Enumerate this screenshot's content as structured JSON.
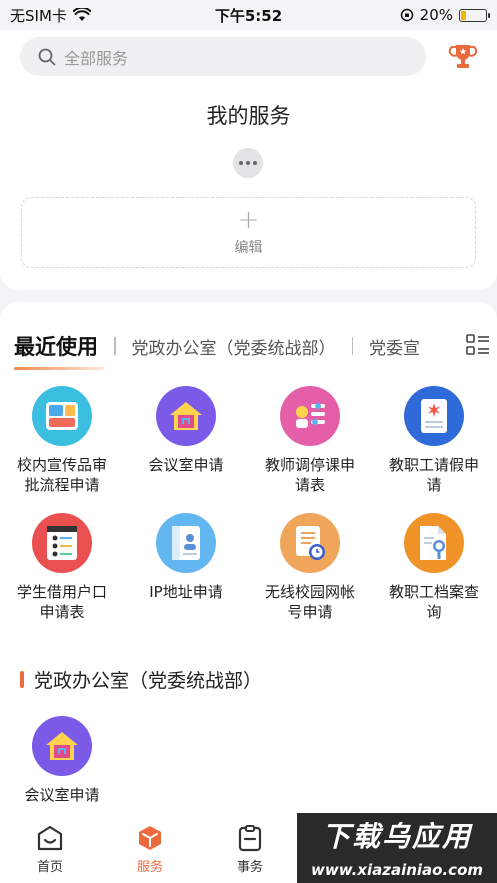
{
  "status_bar": {
    "carrier": "无SIM卡",
    "time": "下午5:52",
    "battery": "20%",
    "battery_level": 0.2
  },
  "search": {
    "placeholder": "全部服务"
  },
  "my_service": {
    "title": "我的服务",
    "edit_label": "编辑"
  },
  "tabs": {
    "active": "最近使用",
    "items": [
      "党政办公室（党委统战部）",
      "党委宣"
    ]
  },
  "recent_services": [
    {
      "label": "校内宣传品审批流程申请",
      "icon": "publicity-doc-icon",
      "color": "#3bbfe0"
    },
    {
      "label": "会议室申请",
      "icon": "meeting-room-icon",
      "color": "#7a5ae6"
    },
    {
      "label": "教师调停课申请表",
      "icon": "schedule-adjust-icon",
      "color": "#e45fa8"
    },
    {
      "label": "教职工请假申请",
      "icon": "leave-request-icon",
      "color": "#2f6bd8"
    },
    {
      "label": "学生借用户口申请表",
      "icon": "household-register-icon",
      "color": "#ea5050"
    },
    {
      "label": "IP地址申请",
      "icon": "ip-address-icon",
      "color": "#63b7f0"
    },
    {
      "label": "无线校园网帐号申请",
      "icon": "wifi-account-icon",
      "color": "#f0a65a"
    },
    {
      "label": "教职工档案查询",
      "icon": "archive-search-icon",
      "color": "#f0942a"
    }
  ],
  "section": {
    "title": "党政办公室（党委统战部）",
    "services": [
      {
        "label": "会议室申请",
        "icon": "meeting-room-icon",
        "color": "#7a5ae6"
      }
    ]
  },
  "tabbar": {
    "items": [
      {
        "label": "首页",
        "icon": "home-icon"
      },
      {
        "label": "服务",
        "icon": "service-cube-icon",
        "active": true
      },
      {
        "label": "事务",
        "icon": "clipboard-icon"
      }
    ]
  },
  "watermark": {
    "text": "下载乌应用",
    "url": "www.xiazainiao.com"
  },
  "colors": {
    "accent": "#ec6a3c",
    "background": "#f4f4f6"
  }
}
